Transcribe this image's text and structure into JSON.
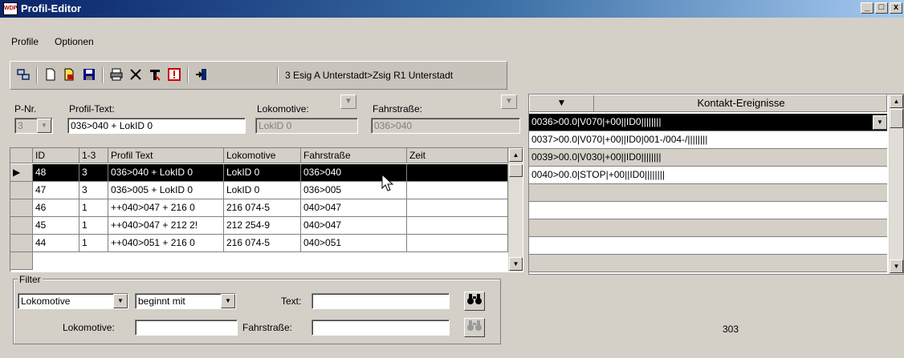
{
  "window": {
    "title": "Profil-Editor",
    "icon_text": "WDP",
    "minimize_glyph": "_",
    "maximize_glyph": "□",
    "close_glyph": "x"
  },
  "menu": [
    "Profile",
    "Optionen"
  ],
  "toolbar": {
    "icons": [
      "printer-setup-icon",
      "new-document-icon",
      "lock-document-icon",
      "save-icon",
      "print-icon",
      "delete-icon",
      "text-tool-icon",
      "alert-icon",
      "exit-icon"
    ],
    "route_label": "3 Esig A Unterstadt>Zsig R1 Unterstadt"
  },
  "form": {
    "pnr_label": "P-Nr.",
    "pnr_value": "3",
    "profile_text_label": "Profil-Text:",
    "profile_text_value": "036>040 + LokID 0",
    "loco_label": "Lokomotive:",
    "loco_value": "LokID 0",
    "route_label": "Fahrstraße:",
    "route_value": "036>040"
  },
  "grid": {
    "columns": [
      "ID",
      "1-3",
      "Profil Text",
      "Lokomotive",
      "Fahrstraße",
      "Zeit"
    ],
    "rows": [
      {
        "id": "48",
        "n": "3",
        "text": "036>040 + LokID 0",
        "loco": "LokID 0",
        "route": "036>040",
        "time": "",
        "selected": true
      },
      {
        "id": "47",
        "n": "3",
        "text": "036>005 + LokID 0",
        "loco": "LokID 0",
        "route": "036>005",
        "time": ""
      },
      {
        "id": "46",
        "n": "1",
        "text": "++040>047 + 216 0",
        "loco": "216 074-5",
        "route": "040>047",
        "time": ""
      },
      {
        "id": "45",
        "n": "1",
        "text": "++040>047 + 212 2!",
        "loco": "212 254-9",
        "route": "040>047",
        "time": ""
      },
      {
        "id": "44",
        "n": "1",
        "text": "++040>051 + 216 0",
        "loco": "216 074-5",
        "route": "040>051",
        "time": ""
      }
    ]
  },
  "filter": {
    "title": "Filter",
    "field_select": "Lokomotive",
    "mode_select": "beginnt mit",
    "text_label": "Text:",
    "loco_label": "Lokomotive:",
    "route_label": "Fahrstraße:"
  },
  "events": {
    "header_arrow": "▼",
    "title": "Kontakt-Ereignisse",
    "rows": [
      "0036>00.0|V070|+00||ID0||||||||",
      "0037>00.0|V070|+00||ID0|001-/004-/||||||||",
      "0039>00.0|V030|+00||ID0||||||||",
      "0040>00.0|STOP|+00||ID0||||||||"
    ]
  },
  "status": {
    "counter": "303"
  }
}
